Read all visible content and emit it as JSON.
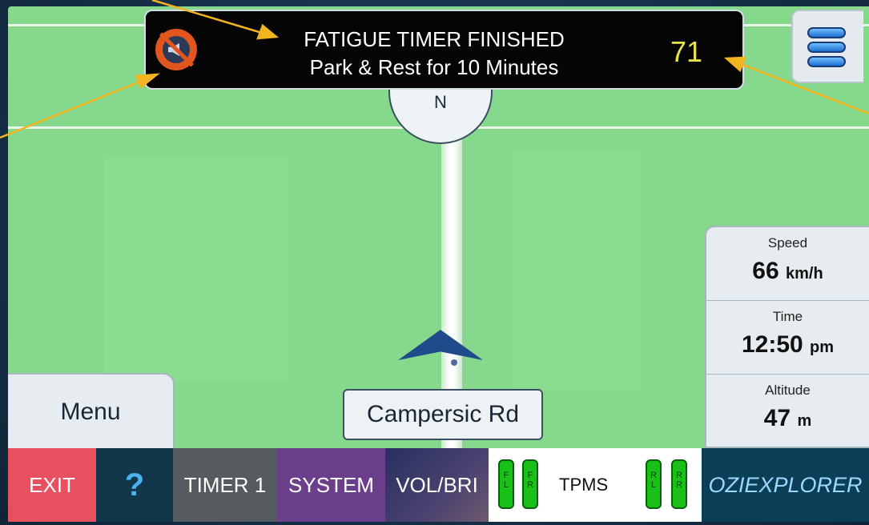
{
  "alert": {
    "icon": "muted-speaker-icon",
    "title": "FATIGUE TIMER FINISHED",
    "subtitle": "Park & Rest for 10 Minutes",
    "countdown": "71"
  },
  "compass": {
    "heading": "N"
  },
  "street": {
    "name": "Campersic Rd"
  },
  "info_panel": {
    "speed": {
      "label": "Speed",
      "value": "66",
      "unit": "km/h"
    },
    "time": {
      "label": "Time",
      "value": "12:50",
      "unit": "pm"
    },
    "altitude": {
      "label": "Altitude",
      "value": "47",
      "unit": "m"
    }
  },
  "menu_tab": {
    "label": "Menu"
  },
  "toolbar": {
    "exit": {
      "label": "EXIT",
      "color": "#e8505f"
    },
    "help": {
      "label": "?",
      "color": "#13374a"
    },
    "timer": {
      "label": "TIMER 1",
      "color": "#555b5f"
    },
    "system": {
      "label": "SYSTEM",
      "color": "#6b3f8c"
    },
    "volbri": {
      "label": "VOL/BRI",
      "color": "#3a3a6a"
    },
    "tpms": {
      "label": "TPMS",
      "tires": [
        {
          "top": "F",
          "bottom": "L"
        },
        {
          "top": "F",
          "bottom": "R"
        },
        {
          "top": "R",
          "bottom": "L"
        },
        {
          "top": "R",
          "bottom": "R"
        }
      ]
    },
    "ozi": {
      "label": "OZIEXPLORER"
    }
  },
  "colors": {
    "map_bg": "#86d98c",
    "alert_text": "#ffffff",
    "countdown": "#e8e34a",
    "callout": "#f3b51f"
  }
}
